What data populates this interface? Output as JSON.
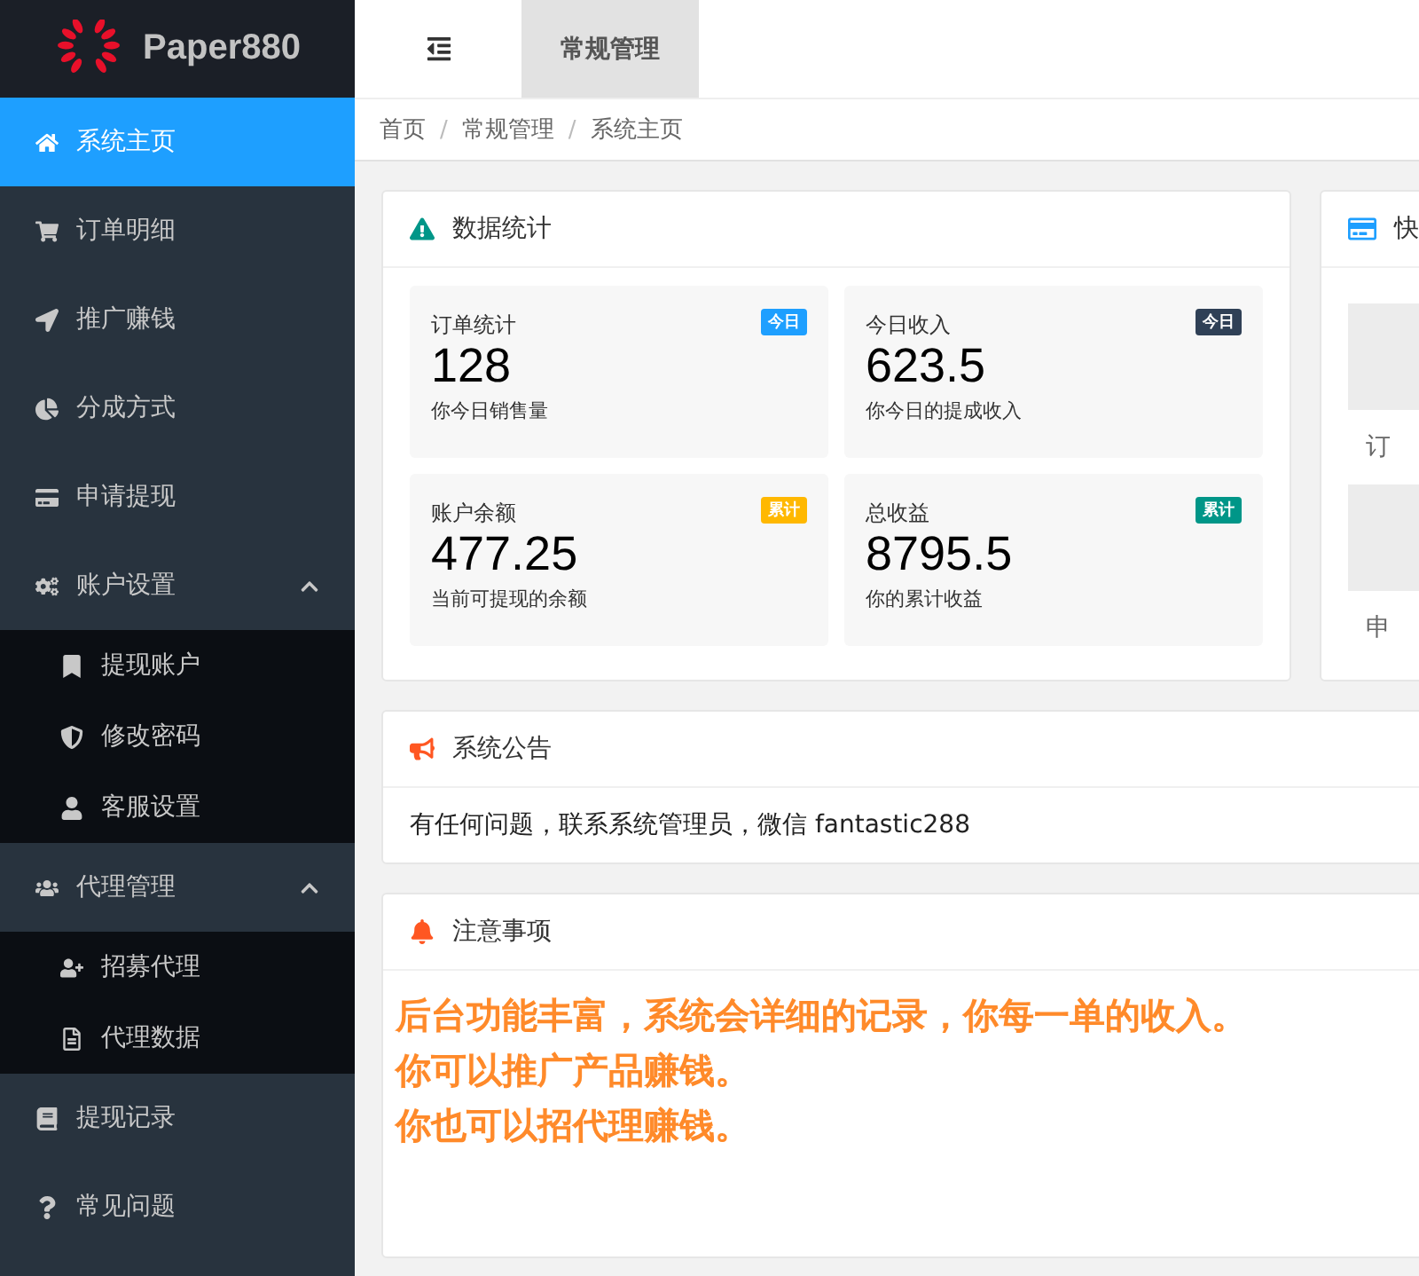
{
  "logo": {
    "text": "Paper880"
  },
  "sidebar": {
    "items": [
      {
        "label": "系统主页",
        "selected": true
      },
      {
        "label": "订单明细",
        "selected": false
      },
      {
        "label": "推广赚钱",
        "selected": false
      },
      {
        "label": "分成方式",
        "selected": false
      },
      {
        "label": "申请提现",
        "selected": false
      },
      {
        "label": "账户设置",
        "selected": false,
        "expanded": true,
        "children": [
          {
            "label": "提现账户",
            "selected": false
          },
          {
            "label": "修改密码",
            "selected": false
          },
          {
            "label": "客服设置",
            "selected": false
          }
        ]
      },
      {
        "label": "代理管理",
        "selected": false,
        "expanded": true,
        "children": [
          {
            "label": "招募代理",
            "selected": false
          },
          {
            "label": "代理数据",
            "selected": false
          }
        ]
      },
      {
        "label": "提现记录",
        "selected": false
      },
      {
        "label": "常见问题",
        "selected": false
      }
    ]
  },
  "tabs": [
    {
      "label": "常规管理",
      "selected": true
    }
  ],
  "breadcrumb": {
    "items": [
      "首页",
      "常规管理",
      "系统主页"
    ],
    "separator": "/"
  },
  "stats_card": {
    "title": "数据统计",
    "tiles": [
      {
        "label": "订单统计",
        "badge": "今日",
        "color": "#1e9fff",
        "value": "128",
        "caption": "你今日销售量"
      },
      {
        "label": "今日收入",
        "badge": "今日",
        "color": "#2f4056",
        "value": "623.5",
        "caption": "你今日的提成收入"
      },
      {
        "label": "账户余额",
        "badge": "累计",
        "color": "#ffb800",
        "value": "477.25",
        "caption": "当前可提现的余额"
      },
      {
        "label": "总收益",
        "badge": "累计",
        "color": "#009688",
        "value": "8795.5",
        "caption": "你的累计收益"
      }
    ]
  },
  "shortcut_card": {
    "title": "快",
    "items": [
      "订",
      "申"
    ]
  },
  "notice_card": {
    "title": "系统公告",
    "text": "有任何问题，联系系统管理员，微信 fantastic288"
  },
  "notes_card": {
    "title": "注意事项",
    "lines": [
      "后台功能丰富，系统会详细的记录，你每一单的收入。",
      "你可以推广产品赚钱。",
      "你也可以招代理赚钱。"
    ]
  }
}
